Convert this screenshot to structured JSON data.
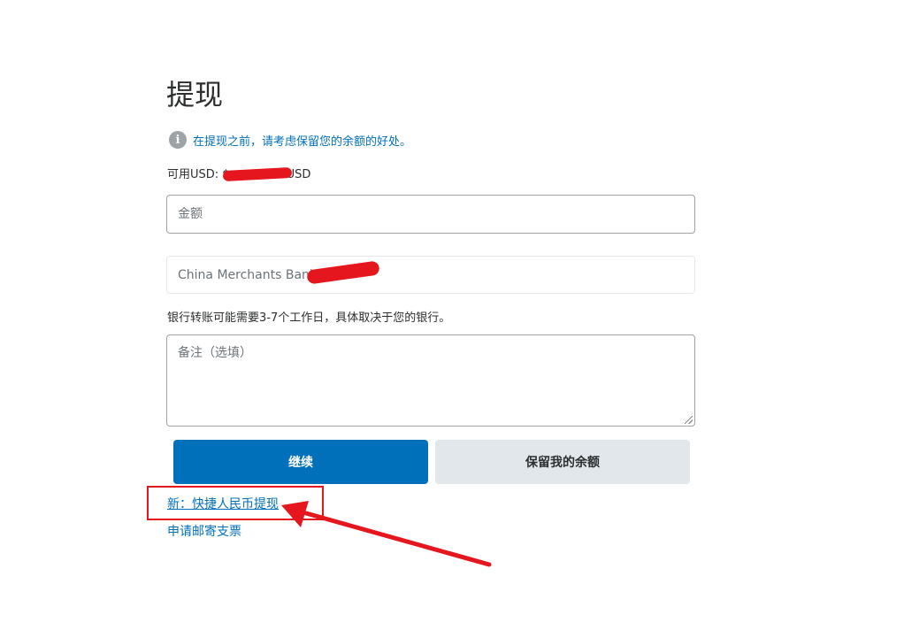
{
  "page": {
    "title": "提现"
  },
  "info": {
    "text": "在提现之前，请考虑保留您的余额的好处。",
    "icon": "info-icon"
  },
  "balance": {
    "prefix": "可用USD: $",
    "suffix": "USD"
  },
  "amount": {
    "placeholder": "金额",
    "value": ""
  },
  "bank": {
    "label": "China Merchants Bank x-"
  },
  "transfer_note": "银行转账可能需要3-7个工作日，具体取决于您的银行。",
  "memo": {
    "placeholder": "备注（选填）",
    "value": ""
  },
  "buttons": {
    "continue": "继续",
    "keep_balance": "保留我的余额"
  },
  "links": {
    "rmb_withdraw": "新：快捷人民币提现",
    "mail_check": "申请邮寄支票"
  },
  "colors": {
    "accent": "#0070ba",
    "text": "#2c2e2f",
    "muted": "#6c7378",
    "secondary_button": "#e1e7eb",
    "annotation": "#e5161d"
  }
}
